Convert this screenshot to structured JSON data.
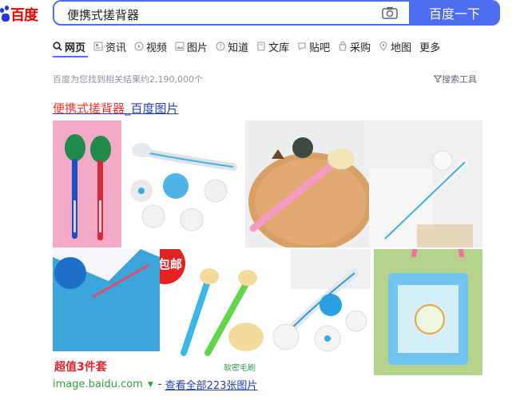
{
  "logo": {
    "text": "百度"
  },
  "search": {
    "query": "便携式搓背器",
    "button": "百度一下"
  },
  "tabs": [
    {
      "label": "网页",
      "icon": "search-icon",
      "active": true
    },
    {
      "label": "资讯",
      "icon": "news-icon"
    },
    {
      "label": "视频",
      "icon": "video-icon"
    },
    {
      "label": "图片",
      "icon": "image-icon"
    },
    {
      "label": "知道",
      "icon": "question-icon"
    },
    {
      "label": "文库",
      "icon": "document-icon"
    },
    {
      "label": "贴吧",
      "icon": "forum-icon"
    },
    {
      "label": "采购",
      "icon": "shopping-icon"
    },
    {
      "label": "地图",
      "icon": "map-pin-icon"
    },
    {
      "label": "更多",
      "icon": ""
    }
  ],
  "result_count": "百度为您找到相关结果约2,190,000个",
  "tools": {
    "label": "搜索工具",
    "icon": "filter-icon"
  },
  "result": {
    "keyword": "便携式搓背器",
    "suffix": "_百度图片"
  },
  "images": [
    {
      "name": "image-red-blue-brushes"
    },
    {
      "name": "image-white-brush-with-pads"
    },
    {
      "name": "image-pink-brush-on-tray"
    },
    {
      "name": "image-white-brush-on-towel"
    },
    {
      "name": "image-blue-towel-set"
    },
    {
      "name": "image-green-blue-brushes"
    },
    {
      "name": "image-white-brush-with-sponge"
    },
    {
      "name": "image-blue-boxed-brush"
    }
  ],
  "overlay_text": {
    "promo": "包邮",
    "badge": "超值3件套",
    "soft": "软密毛刷"
  },
  "footer": {
    "site": "image.baidu.com",
    "more": "查看全部223张图片"
  },
  "colors": {
    "brand_blue": "#4e6ef2",
    "keyword_red": "#f73131",
    "link_blue": "#2440b3",
    "site_green": "#32a03c"
  }
}
